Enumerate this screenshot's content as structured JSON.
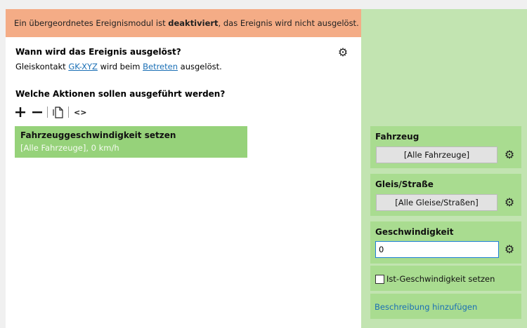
{
  "warning": {
    "prefix": "Ein übergeordnetes Ereignismodul ist ",
    "bold": "deaktiviert",
    "suffix": ", das Ereignis wird nicht ausgelöst."
  },
  "trigger": {
    "heading": "Wann wird das Ereignis ausgelöst?",
    "desc_prefix": "Gleiskontakt ",
    "contact_link": "GK-XYZ",
    "desc_middle": " wird beim ",
    "event_link": "Betreten",
    "desc_suffix": " ausgelöst."
  },
  "actions": {
    "heading": "Welche Aktionen sollen ausgeführt werden?",
    "toolbar": {
      "add_icon": "plus-icon",
      "remove_icon": "minus-icon",
      "copy_icon": "copy-icon",
      "code_label": "<>"
    },
    "items": [
      {
        "title": "Fahrzeuggeschwindigkeit setzen",
        "subtitle": "[Alle Fahrzeuge], 0 km/h"
      }
    ]
  },
  "properties": {
    "vehicle": {
      "label": "Fahrzeug",
      "value": "[Alle Fahrzeuge]"
    },
    "track": {
      "label": "Gleis/Straße",
      "value": "[Alle Gleise/Straßen]"
    },
    "speed": {
      "label": "Geschwindigkeit",
      "value": "0"
    },
    "actual_speed": {
      "label": "Ist-Geschwindigkeit setzen",
      "checked": false
    },
    "add_description": "Beschreibung hinzufügen"
  },
  "colors": {
    "warning_bg": "#f4ac86",
    "sidebar_bg": "#c2e4b1",
    "action_bg": "#96d27a",
    "prop_bg": "#a9dc90",
    "link": "#1a6fb5"
  }
}
